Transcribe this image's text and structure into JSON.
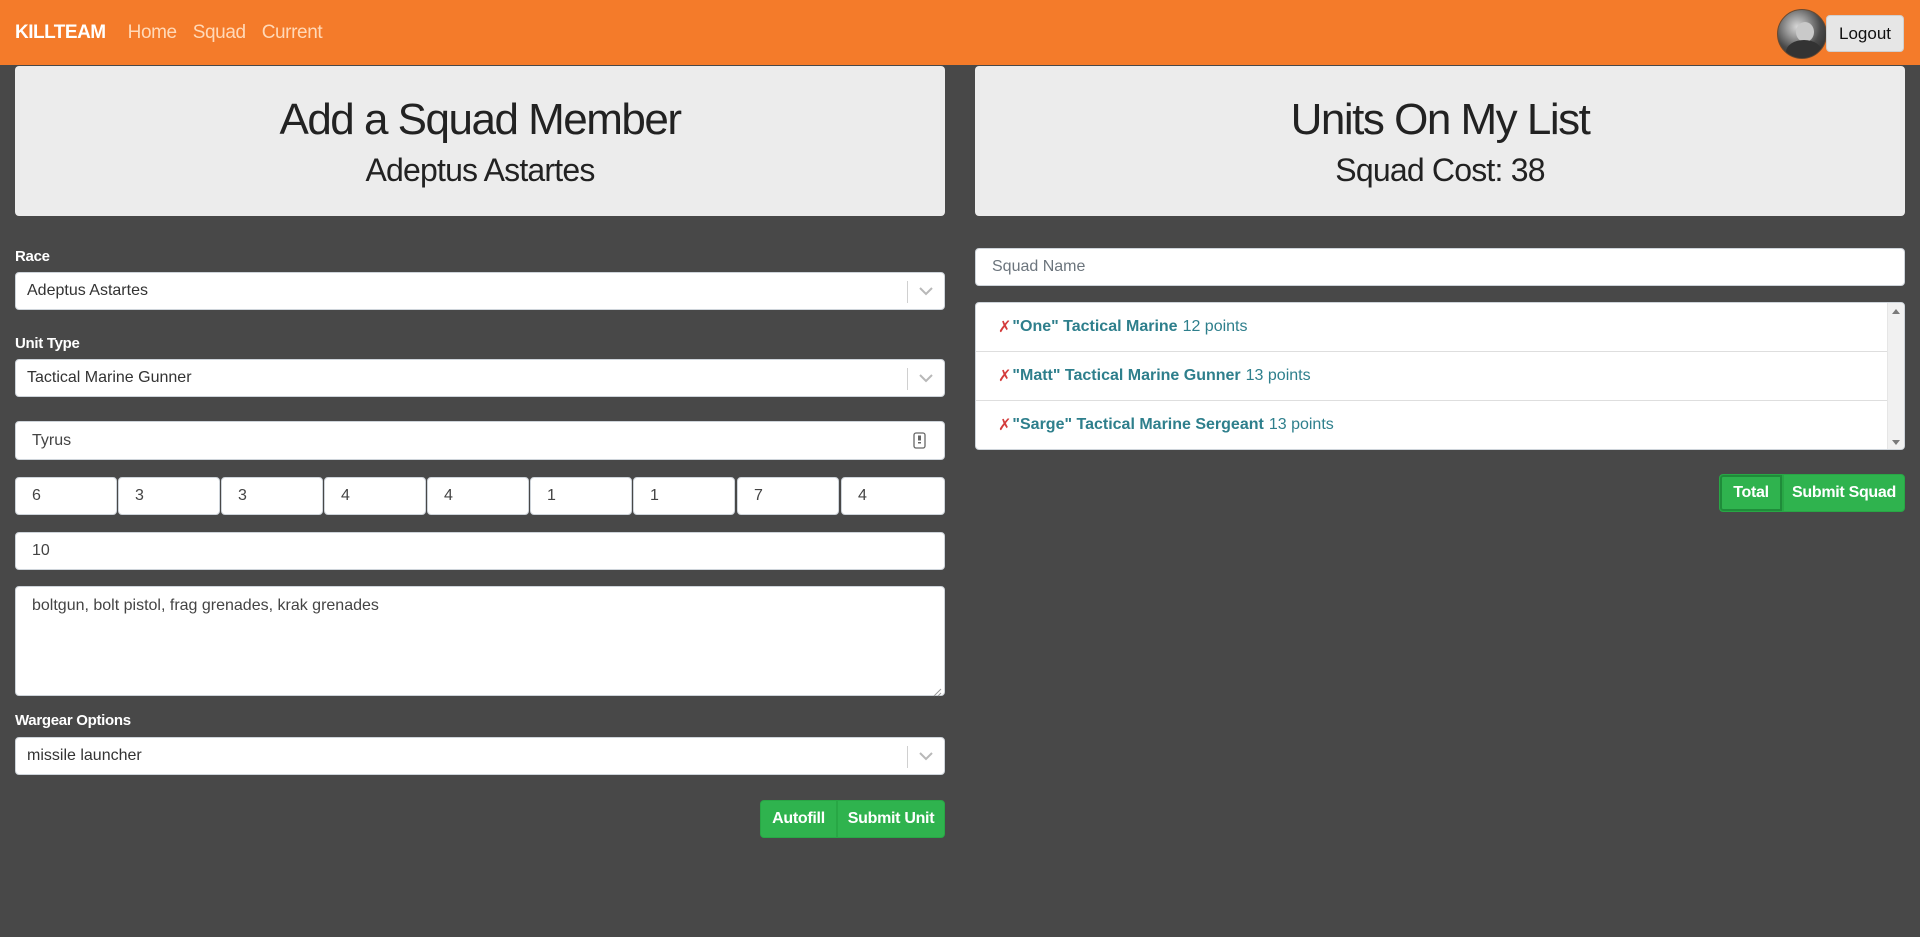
{
  "nav": {
    "brand": "KILLTEAM",
    "links": [
      "Home",
      "Squad",
      "Current"
    ],
    "logout_label": "Logout",
    "accent": "#f47b2a"
  },
  "left_header": {
    "title": "Add a Squad Member",
    "subtitle": "Adeptus Astartes"
  },
  "form": {
    "race_label": "Race",
    "race_value": "Adeptus Astartes",
    "unit_type_label": "Unit Type",
    "unit_type_value": "Tactical Marine Gunner",
    "name_value": "Tyrus",
    "stats": [
      "6",
      "3",
      "3",
      "4",
      "4",
      "1",
      "1",
      "7",
      "4"
    ],
    "points_value": "10",
    "wargear_text": "boltgun, bolt pistol, frag grenades, krak grenades",
    "wargear_options_label": "Wargear Options",
    "wargear_options_value": "missile launcher",
    "autofill_label": "Autofill",
    "submit_unit_label": "Submit Unit"
  },
  "right_header": {
    "title": "Units On My List",
    "subtitle": "Squad Cost: 38"
  },
  "squad": {
    "name_placeholder": "Squad Name",
    "units": [
      {
        "remove": "✗",
        "name": "\"One\" Tactical Marine",
        "points": "12 points"
      },
      {
        "remove": "✗",
        "name": "\"Matt\" Tactical Marine Gunner",
        "points": "13 points"
      },
      {
        "remove": "✗",
        "name": "\"Sarge\" Tactical Marine Sergeant",
        "points": "13 points"
      }
    ],
    "total_label": "Total",
    "submit_squad_label": "Submit Squad"
  },
  "colors": {
    "background": "#484848",
    "button_green": "#2fb34e",
    "link_teal": "#2e7f8c",
    "remove_red": "#d43c3c"
  }
}
